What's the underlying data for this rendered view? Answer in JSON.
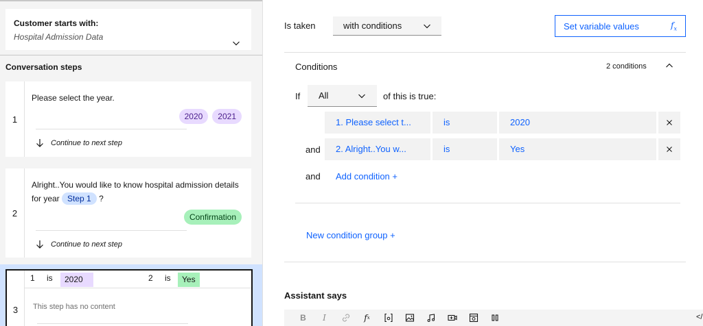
{
  "left": {
    "starts": {
      "label": "Customer starts with:",
      "value": "Hospital Admission Data"
    },
    "conversation_title": "Conversation steps",
    "steps": [
      {
        "number": "1",
        "text": "Please select the year.",
        "options": [
          "2020",
          "2021"
        ],
        "next": "Continue to next step"
      },
      {
        "number": "2",
        "text_before": "Alright..You would like to know hospital admission details for year",
        "variable": "Step 1",
        "text_after": "?",
        "options": [
          "Confirmation"
        ],
        "next": "Continue to next step"
      },
      {
        "number": "3",
        "conditions": [
          {
            "step": "1",
            "op": "is",
            "value": "2020"
          },
          {
            "step": "2",
            "op": "is",
            "value": "Yes"
          }
        ],
        "empty_text": "This step has no content"
      }
    ]
  },
  "right": {
    "is_taken_label": "Is taken",
    "is_taken_value": "with conditions",
    "set_variable_label": "Set variable values",
    "set_variable_icon": "fx-icon",
    "conditions": {
      "title": "Conditions",
      "count": "2 conditions",
      "if_label": "If",
      "match": "All",
      "suffix": "of this is true:",
      "rows": [
        {
          "connector": "",
          "subject": "1. Please select t...",
          "operator": "is",
          "value": "2020"
        },
        {
          "connector": "and",
          "subject": "2. Alright..You w...",
          "operator": "is",
          "value": "Yes"
        }
      ],
      "add_connector": "and",
      "add_label": "Add condition +",
      "new_group_label": "New condition group +"
    },
    "assistant_says": "Assistant says",
    "toolbar": {
      "bold": "B",
      "italic": "I",
      "items": [
        "bold-icon",
        "italic-icon",
        "link-icon",
        "fx-icon",
        "variable-icon",
        "image-icon",
        "audio-icon",
        "video-icon",
        "iframe-icon",
        "pause-icon",
        "code-icon"
      ],
      "code_glyph": "</"
    }
  },
  "colors": {
    "accent": "#0f62fe",
    "chip_purple": "#e8daff",
    "chip_green": "#a7f0ba",
    "chip_blue": "#d0e2ff",
    "selected_bg": "#d0e2ff"
  }
}
